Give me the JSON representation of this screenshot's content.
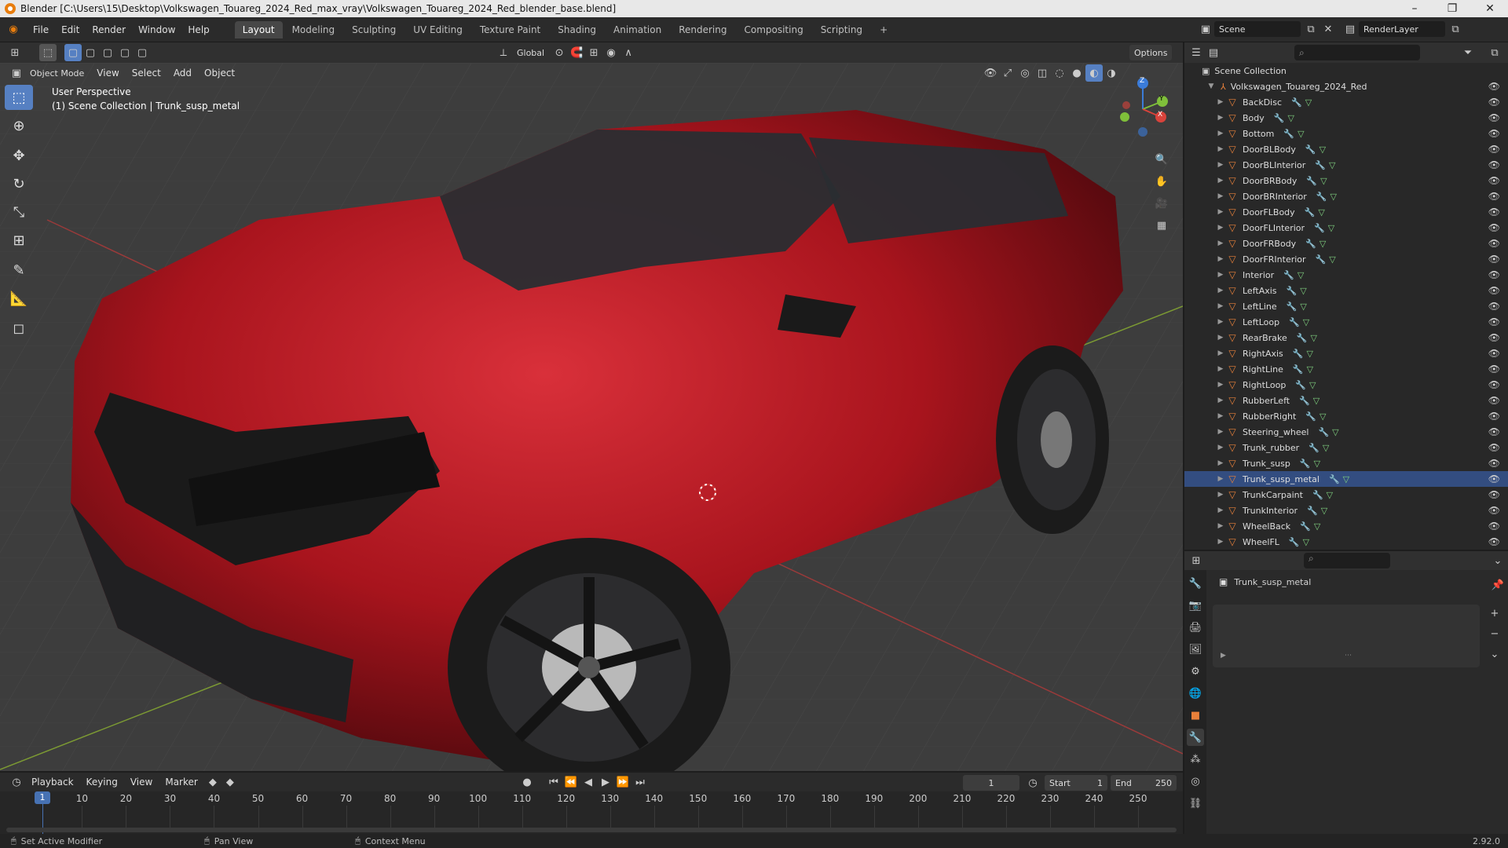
{
  "window": {
    "title": "Blender [C:\\Users\\15\\Desktop\\Volkswagen_Touareg_2024_Red_max_vray\\Volkswagen_Touareg_2024_Red_blender_base.blend]",
    "minimize": "–",
    "maximize": "❐",
    "close": "✕"
  },
  "menu": {
    "items": [
      "File",
      "Edit",
      "Render",
      "Window",
      "Help"
    ]
  },
  "workspaces": [
    "Layout",
    "Modeling",
    "Sculpting",
    "UV Editing",
    "Texture Paint",
    "Shading",
    "Animation",
    "Rendering",
    "Compositing",
    "Scripting"
  ],
  "workspace_add": "+",
  "scene": {
    "name": "Scene",
    "layer": "RenderLayer"
  },
  "viewport_header": {
    "mode": "Object Mode",
    "menus": [
      "View",
      "Select",
      "Add",
      "Object"
    ],
    "transform": "Global",
    "options": "Options"
  },
  "viewport": {
    "perspective": "User Perspective",
    "context": "(1) Scene Collection | Trunk_susp_metal"
  },
  "gizmo": {
    "x": "X",
    "y": "Y",
    "z": "Z"
  },
  "outliner": {
    "root": "Scene Collection",
    "collection": "Volkswagen_Touareg_2024_Red",
    "objects": [
      "BackDisc",
      "Body",
      "Bottom",
      "DoorBLBody",
      "DoorBLInterior",
      "DoorBRBody",
      "DoorBRInterior",
      "DoorFLBody",
      "DoorFLInterior",
      "DoorFRBody",
      "DoorFRInterior",
      "Interior",
      "LeftAxis",
      "LeftLine",
      "LeftLoop",
      "RearBrake",
      "RightAxis",
      "RightLine",
      "RightLoop",
      "RubberLeft",
      "RubberRight",
      "Steering_wheel",
      "Trunk_rubber",
      "Trunk_susp",
      "Trunk_susp_metal",
      "TrunkCarpaint",
      "TrunkInterior",
      "WheelBack",
      "WheelFL"
    ],
    "selected": "Trunk_susp_metal"
  },
  "properties": {
    "object": "Trunk_susp_metal"
  },
  "timeline": {
    "menus": [
      "Playback",
      "Keying",
      "View",
      "Marker"
    ],
    "current": "1",
    "start_label": "Start",
    "start": "1",
    "end_label": "End",
    "end": "250",
    "frames": [
      "1",
      "10",
      "20",
      "30",
      "40",
      "50",
      "60",
      "70",
      "80",
      "90",
      "100",
      "110",
      "120",
      "130",
      "140",
      "150",
      "160",
      "170",
      "180",
      "190",
      "200",
      "210",
      "220",
      "230",
      "240",
      "250"
    ]
  },
  "status": {
    "left": "Set Active Modifier",
    "mid": "Pan View",
    "right": "Context Menu",
    "version": "2.92.0"
  },
  "colors": {
    "accent": "#5680c2",
    "car": "#b3131c",
    "grid": "#3d3d3d"
  }
}
